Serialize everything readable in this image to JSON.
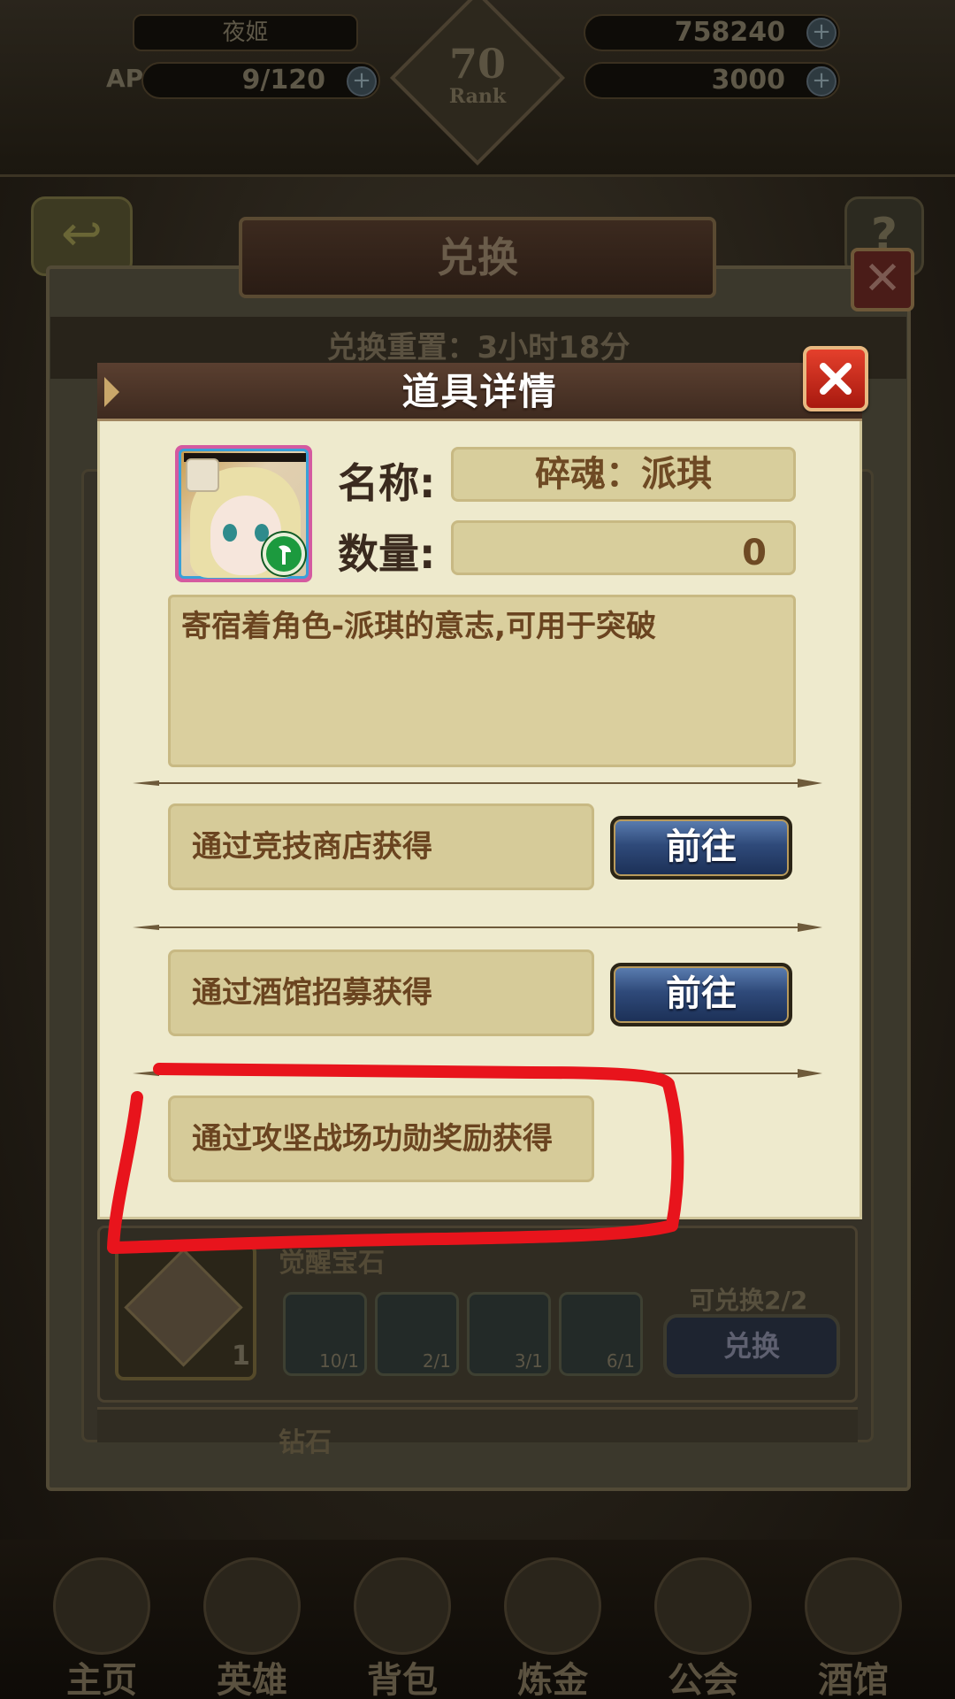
{
  "background": {
    "player_name": "夜姬",
    "stamina": "9/120",
    "stamina_prefix": "AP",
    "gold": "758240",
    "gems": "3000",
    "rank_number": "70",
    "rank_label": "Rank",
    "shop_title": "兑换",
    "reset_text": "兑换重置：3小时18分",
    "row_item_name": "觉醒宝石",
    "row_item_count": "1",
    "materials": [
      "10/1",
      "2/1",
      "3/1",
      "6/1"
    ],
    "exchange_limit": "可兑换2/2",
    "exchange_button": "兑换",
    "row2_item_name": "钻石",
    "nav_items": [
      "主页",
      "英雄",
      "背包",
      "炼金",
      "公会",
      "酒馆"
    ]
  },
  "modal": {
    "title": "道具详情",
    "name_label": "名称:",
    "name_value": "碎魂：派琪",
    "quantity_label": "数量:",
    "quantity_value": "0",
    "description": "寄宿着角色-派琪的意志,可用于突破",
    "sources": [
      {
        "text": "通过竞技商店获得",
        "button": "前往"
      },
      {
        "text": "通过酒馆招募获得",
        "button": "前往"
      },
      {
        "text": "通过攻坚战场功勋奖励获得"
      }
    ]
  },
  "colors": {
    "annotation_red": "#e8141c",
    "goto_button": "#2f4a7a",
    "close_button": "#c82a1c",
    "modal_bg": "#eeeacd"
  }
}
